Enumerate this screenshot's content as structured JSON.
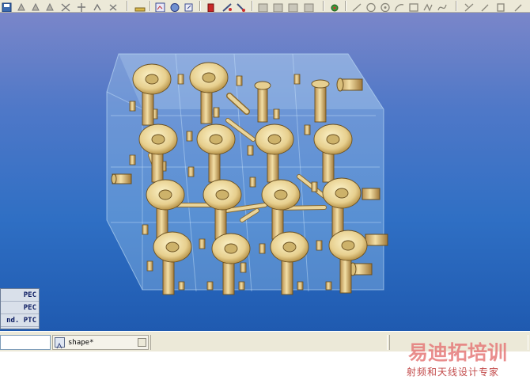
{
  "materials": [
    "PEC",
    "PEC",
    "nd. PTC"
  ],
  "tab": {
    "label": "shape*"
  },
  "watermark": {
    "title": "易迪拓培训",
    "subtitle": "射频和天线设计专家"
  },
  "colors": {
    "background_top": "#7a86c9",
    "background_bottom": "#1f5ab0",
    "metal_gold": "#e0c88a",
    "dielectric_box": "#9ec8ee"
  },
  "icons": [
    "save-icon",
    "rotate-icon",
    "zoom-icon",
    "fit-icon",
    "select-icon",
    "pick-icon",
    "material-icon",
    "draw-line-icon",
    "draw-circle-icon",
    "draw-box-icon",
    "draw-curve-icon"
  ]
}
